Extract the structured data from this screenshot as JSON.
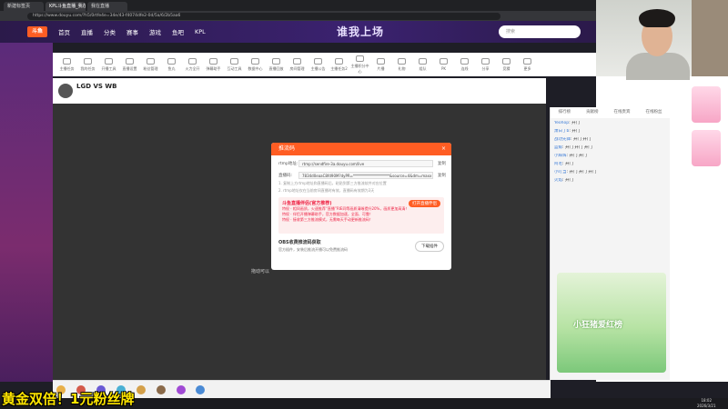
{
  "browser": {
    "tabs": [
      "新建标签页",
      "KPL斗鱼直播_我在直播_DOU...",
      "我在直播"
    ],
    "url": "https://www.douyu.com/?h5/0rtfe4e=34e/43-f4074dfe2-0d/5a/6/2b5aa6"
  },
  "header": {
    "logo": "斗鱼",
    "nav": [
      "首页",
      "直播",
      "分类",
      "赛事",
      "游戏",
      "鱼吧",
      "KPL"
    ],
    "banner": "谁我上场",
    "search_placeholder": "搜索"
  },
  "categories": [
    "主播任务",
    "我的任务",
    "开播工具",
    "直播设置",
    "粉丝管理",
    "鱼丸",
    "火力全开",
    "弹幕助手",
    "互动工具",
    "数据中心",
    "直播回放",
    "房间管理",
    "主播公告",
    "主播任务2",
    "主播积分中心",
    "片播",
    "礼物",
    "组队",
    "PK",
    "连线",
    "分享",
    "竞猜",
    "更多"
  ],
  "room": {
    "title": "LGD VS WB",
    "follow_count": "0"
  },
  "video": {
    "placeholder": "拖动可以"
  },
  "modal": {
    "title": "推流码",
    "rtmp_label": "rtmp地址:",
    "rtmp_value": "rtmp://sendfire-3a.douyu.com/live",
    "key_label": "直播码:",
    "key_value": "7834d0eaaC8fd90M?dyPR=********************&source=4&dm=maxx",
    "copy": "复制",
    "note1": "1. 复制上方rtmp地址和直播码后，粘贴到第三方推流软件对应位置",
    "note2": "2. rtmp地址仅在当前房间直播时有效，直播码有效期为3天",
    "promo_title": "斗鱼直播伴侣(官方推荐)",
    "promo_tag": "推荐使用",
    "promo_button": "打开直播伴侣",
    "promo_lines": [
      "特权 · 相同画质，火速推荐“直播”RIE同等画质清晰提升20%，画质更加高清！",
      "特权 · 伴侣开播弹幕助手，官方数据加速，全面、可靠！",
      "特权 · 接收第三方推流模式，无需每天手动更新推流码！"
    ],
    "obs_title": "OBS收费推流码获取",
    "obs_tag": "推荐使用",
    "obs_desc": "官方插件，安装后推流开播可以免费推流码",
    "obs_button": "下载插件"
  },
  "chat": {
    "tabs": [
      "排行榜",
      "贡献榜",
      "在线贵宾",
      "在线粉丝"
    ],
    "messages": [
      {
        "user": "Yeohop",
        "text": "开门"
      },
      {
        "user": "萧白丁b",
        "text": "开门"
      },
      {
        "user": "战功先锋",
        "text": "开门 开门"
      },
      {
        "user": "蓝鲸",
        "text": "开门 开门 开门"
      },
      {
        "user": "小辉辉",
        "text": "开门 开门"
      },
      {
        "user": "阿毛",
        "text": "开门"
      },
      {
        "user": "小叮当",
        "text": "开门 开门 开门"
      },
      {
        "user": "火焰",
        "text": "开门"
      }
    ],
    "promo": "小狂猪爱红榜"
  },
  "overlay_caption": "黄金双倍！1元粉丝牌",
  "clock": {
    "time": "18:02",
    "date": "2026/3/21"
  }
}
